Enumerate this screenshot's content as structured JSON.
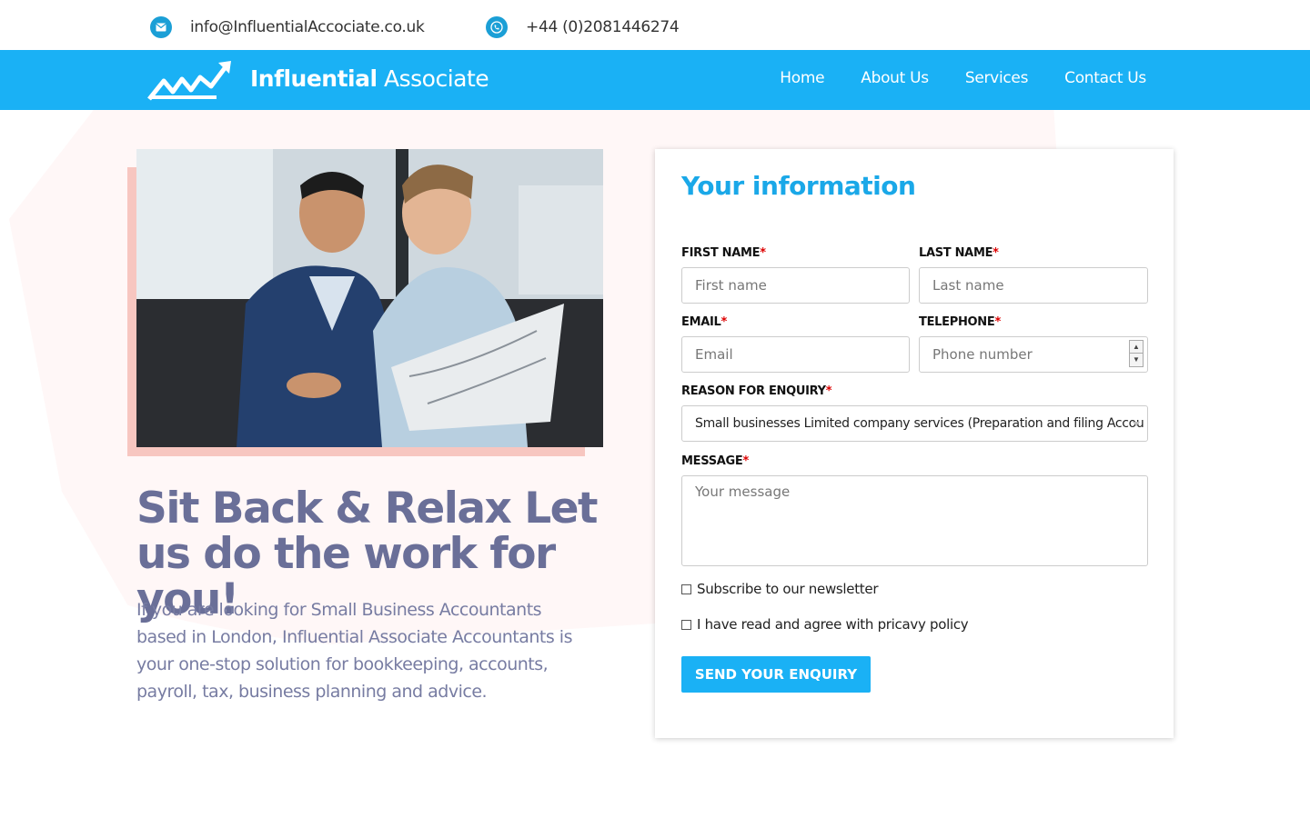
{
  "topbar": {
    "email": "info@InfluentialAccociate.co.uk",
    "phone": "+44 (0)2081446274",
    "email_icon": "envelope-icon",
    "phone_icon": "phone-icon"
  },
  "navbar": {
    "brand_bold": "Influential",
    "brand_rest": " Associate",
    "items": [
      {
        "label": "Home"
      },
      {
        "label": "About Us"
      },
      {
        "label": "Services"
      },
      {
        "label": "Contact Us"
      }
    ],
    "color": "#1ab1f5"
  },
  "hero": {
    "headline": "Sit Back & Relax Let us do the work for you!",
    "paragraph": "If you are looking for Small Business Accountants based in London, Influential Associate Accountants is your one-stop solution for bookkeeping, accounts, payroll, tax, business planning and advice."
  },
  "form": {
    "title": "Your information",
    "first_name_label": "FIRST NAME",
    "first_name_placeholder": "First name",
    "last_name_label": "LAST NAME",
    "last_name_placeholder": "Last name",
    "email_label": "EMAIL",
    "email_placeholder": "Email",
    "telephone_label": "TELEPHONE",
    "telephone_placeholder": "Phone number",
    "reason_label": "REASON FOR ENQUIRY",
    "reason_value": "Small businesses Limited company services (Preparation and filing Accou",
    "message_label": "MESSAGE",
    "message_placeholder": "Your message",
    "newsletter_label": "Subscribe to our newsletter",
    "privacy_label": "I have read and agree with pricavy policy",
    "submit_label": "Send your enquiry",
    "required_mark": "*"
  }
}
